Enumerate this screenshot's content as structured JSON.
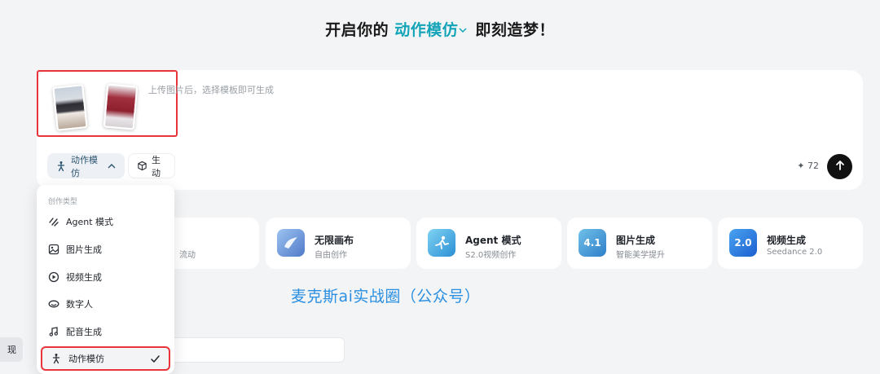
{
  "headline": {
    "prefix": "开启你的",
    "mode": "动作模仿",
    "suffix": "即刻造梦！"
  },
  "composer": {
    "placeholder": "上传图片后，选择模板即可生成",
    "mode_pill": "动作模仿",
    "gen_pill": "生动",
    "credits": "72"
  },
  "feature_cards": [
    {
      "title": "",
      "subtitle": "流动"
    },
    {
      "title": "无限画布",
      "subtitle": "自由创作",
      "icon_color": "#5b8fd6"
    },
    {
      "title": "Agent 模式",
      "subtitle": "S2.0视频创作",
      "icon_color": "#3fa8e0"
    },
    {
      "title": "图片生成",
      "subtitle": "智能美学提升",
      "icon_label": "4.1",
      "icon_color": "#2f8ed1"
    },
    {
      "title": "视频生成",
      "subtitle": "Seedance 2.0",
      "icon_label": "2.0",
      "icon_color": "#1f6fdc"
    }
  ],
  "watermark": "麦克斯ai实战圈（公众号）",
  "left_chip": "现",
  "dropdown": {
    "header": "创作类型",
    "items": [
      {
        "label": "Agent 模式",
        "icon": "agent-icon"
      },
      {
        "label": "图片生成",
        "icon": "image-icon"
      },
      {
        "label": "视频生成",
        "icon": "video-icon"
      },
      {
        "label": "数字人",
        "icon": "digital-human-icon"
      },
      {
        "label": "配音生成",
        "icon": "music-note-icon"
      },
      {
        "label": "动作模仿",
        "icon": "motion-icon",
        "selected": true
      }
    ]
  },
  "colors": {
    "accent": "#13a4b8",
    "highlight_border": "#e8353b",
    "watermark": "#2a8fe0"
  }
}
